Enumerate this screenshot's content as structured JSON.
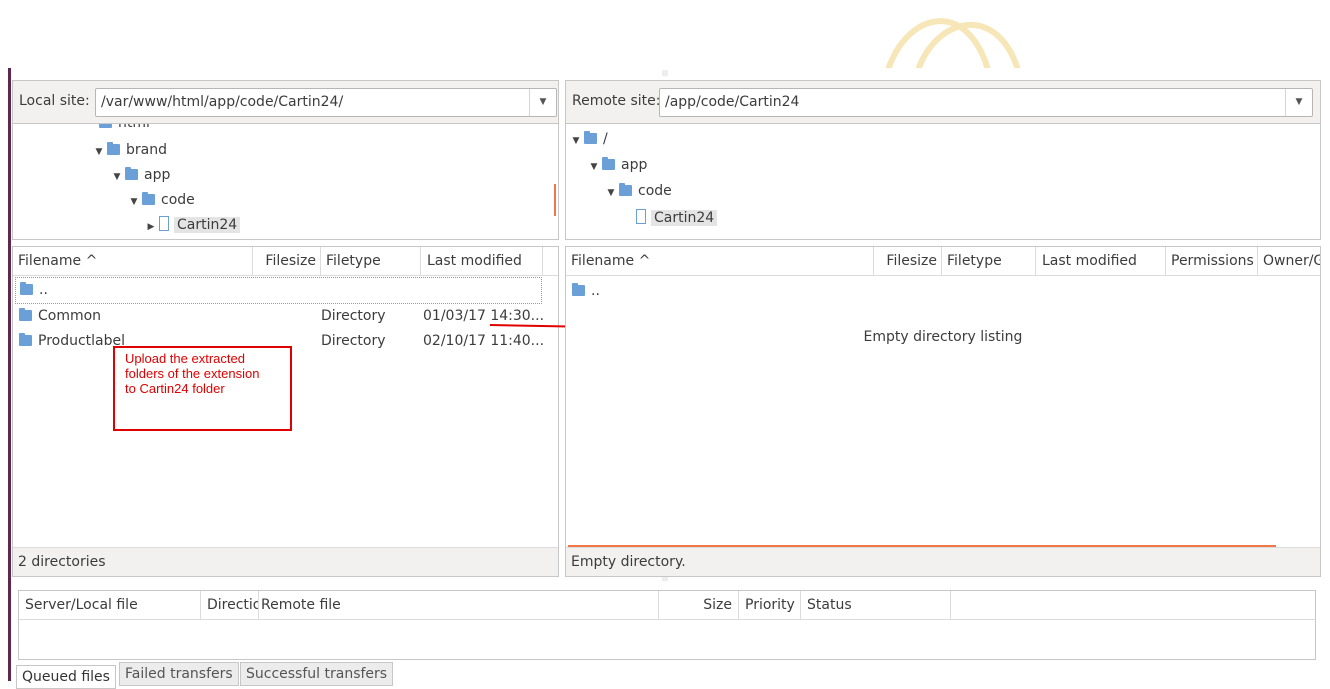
{
  "local": {
    "site_label": "Local site:",
    "site_path": "/var/www/html/app/code/Cartin24/",
    "tree": [
      {
        "label": "html",
        "icon": "folder-icon",
        "expander": "none"
      },
      {
        "label": "brand",
        "icon": "folder-icon",
        "expander": "▼"
      },
      {
        "label": "app",
        "icon": "folder-icon",
        "expander": "▼"
      },
      {
        "label": "code",
        "icon": "folder-icon",
        "expander": "▼"
      },
      {
        "label": "Cartin24",
        "icon": "folder-open-icon",
        "expander": "▶",
        "selected": true
      }
    ],
    "columns": [
      "Filename ^",
      "Filesize",
      "Filetype",
      "Last modified"
    ],
    "rows": [
      {
        "name": "..",
        "filesize": "",
        "filetype": "",
        "modified": ""
      },
      {
        "name": "Common",
        "filesize": "",
        "filetype": "Directory",
        "modified": "01/03/17 14:30..."
      },
      {
        "name": "Productlabel",
        "filesize": "",
        "filetype": "Directory",
        "modified": "02/10/17 11:40..."
      }
    ],
    "status": "2 directories"
  },
  "remote": {
    "site_label": "Remote site:",
    "site_path": "/app/code/Cartin24",
    "tree": [
      {
        "label": "/",
        "icon": "folder-icon",
        "expander": "▼"
      },
      {
        "label": "app",
        "icon": "folder-icon",
        "expander": "▼"
      },
      {
        "label": "code",
        "icon": "folder-icon",
        "expander": "▼"
      },
      {
        "label": "Cartin24",
        "icon": "folder-open-icon",
        "expander": "none",
        "selected": true
      }
    ],
    "columns": [
      "Filename ^",
      "Filesize",
      "Filetype",
      "Last modified",
      "Permissions",
      "Owner/G"
    ],
    "rows": [
      {
        "name": ".."
      }
    ],
    "empty_message": "Empty directory listing",
    "status": "Empty directory."
  },
  "annotation": {
    "text_lines": [
      "Upload the extracted",
      "folders of the extension",
      "to Cartin24 folder"
    ],
    "color": "#e00000"
  },
  "queue": {
    "columns": [
      "Server/Local file",
      "Directio",
      "Remote file",
      "Size",
      "Priority",
      "Status"
    ],
    "tabs": [
      "Queued files",
      "Failed transfers",
      "Successful transfers"
    ],
    "active_tab": "Queued files"
  },
  "colors": {
    "accent": "#5e2750",
    "progress": "#f07746",
    "folder": "#6a9fd8"
  }
}
